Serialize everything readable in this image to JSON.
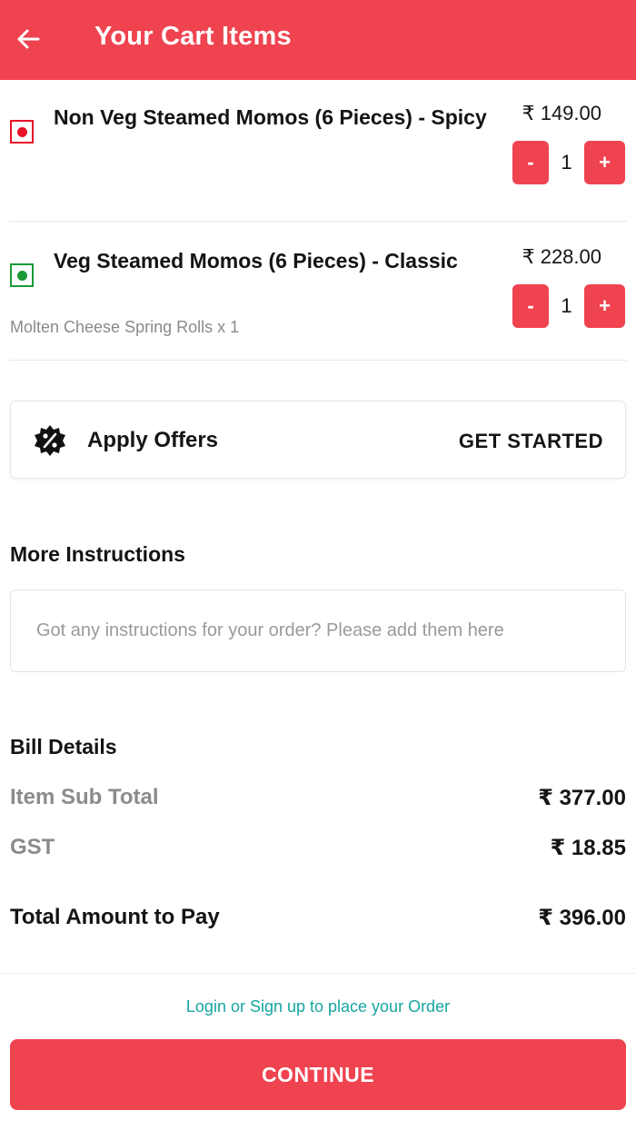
{
  "header": {
    "title": "Your Cart Items",
    "back_icon": "arrow-left-icon"
  },
  "cart": {
    "items": [
      {
        "name": "Non Veg Steamed Momos (6 Pieces)  - Spicy",
        "diet": "non-veg",
        "price": "₹ 149.00",
        "quantity": "1",
        "addon": ""
      },
      {
        "name": "Veg Steamed Momos (6 Pieces)  - Classic",
        "diet": "veg",
        "price": "₹ 228.00",
        "quantity": "1",
        "addon": "Molten Cheese Spring Rolls x 1"
      }
    ],
    "minus_label": "-",
    "plus_label": "+"
  },
  "offers": {
    "icon": "discount-badge-icon",
    "label": "Apply Offers",
    "cta": "GET STARTED"
  },
  "instructions": {
    "title": "More Instructions",
    "placeholder": "Got any instructions for your order? Please add them here",
    "value": ""
  },
  "bill": {
    "title": "Bill Details",
    "rows": [
      {
        "label": "Item Sub Total",
        "value": "₹ 377.00"
      },
      {
        "label": "GST",
        "value": "₹ 18.85"
      }
    ],
    "total": {
      "label": "Total Amount to Pay",
      "value": "₹ 396.00"
    }
  },
  "footer": {
    "login_text": "Login or Sign up to place your Order",
    "continue_label": "CONTINUE"
  },
  "colors": {
    "accent": "#ef4350",
    "link": "#17a5a0",
    "veg": "#1b9a37",
    "non_veg": "#e8132a"
  }
}
